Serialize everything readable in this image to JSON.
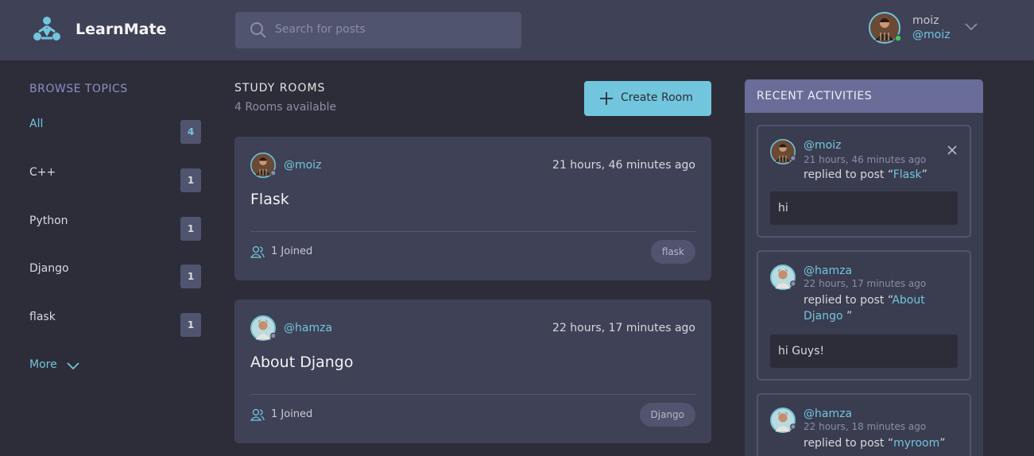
{
  "app": {
    "name": "LearnMate"
  },
  "search": {
    "placeholder": "Search for posts"
  },
  "user": {
    "name": "moiz",
    "handle": "@moiz"
  },
  "topics": {
    "title": "BROWSE TOPICS",
    "items": [
      {
        "label": "All",
        "count": "4"
      },
      {
        "label": "C++",
        "count": "1"
      },
      {
        "label": "Python",
        "count": "1"
      },
      {
        "label": "Django",
        "count": "1"
      },
      {
        "label": "flask",
        "count": "1"
      }
    ],
    "more": "More"
  },
  "rooms": {
    "title": "STUDY ROOMS",
    "subtitle": "4 Rooms available",
    "create_label": "Create Room",
    "items": [
      {
        "host": "@moiz",
        "time": "21 hours, 46 minutes ago",
        "name": "Flask",
        "joined": "1 Joined",
        "topic": "flask"
      },
      {
        "host": "@hamza",
        "time": "22 hours, 17 minutes ago",
        "name": "About Django",
        "joined": "1 Joined",
        "topic": "Django"
      }
    ]
  },
  "activities": {
    "title": "RECENT ACTIVITIES",
    "items": [
      {
        "user": "@moiz",
        "time": "21 hours, 46 minutes ago",
        "action": "replied to post",
        "post": "Flask",
        "message": "hi"
      },
      {
        "user": "@hamza",
        "time": "22 hours, 17 minutes ago",
        "action": "replied to post",
        "post": "About Django ",
        "message": "hi Guys!"
      },
      {
        "user": "@hamza",
        "time": "22 hours, 18 minutes ago",
        "action": "replied to post",
        "post": "myroom",
        "message": ""
      }
    ]
  },
  "colors": {
    "accent": "#71c6dd",
    "background": "#2d2d39",
    "header": "#3f4156",
    "panel_header": "#696d97",
    "online": "#43c65b",
    "offline": "#8b8ea5"
  }
}
